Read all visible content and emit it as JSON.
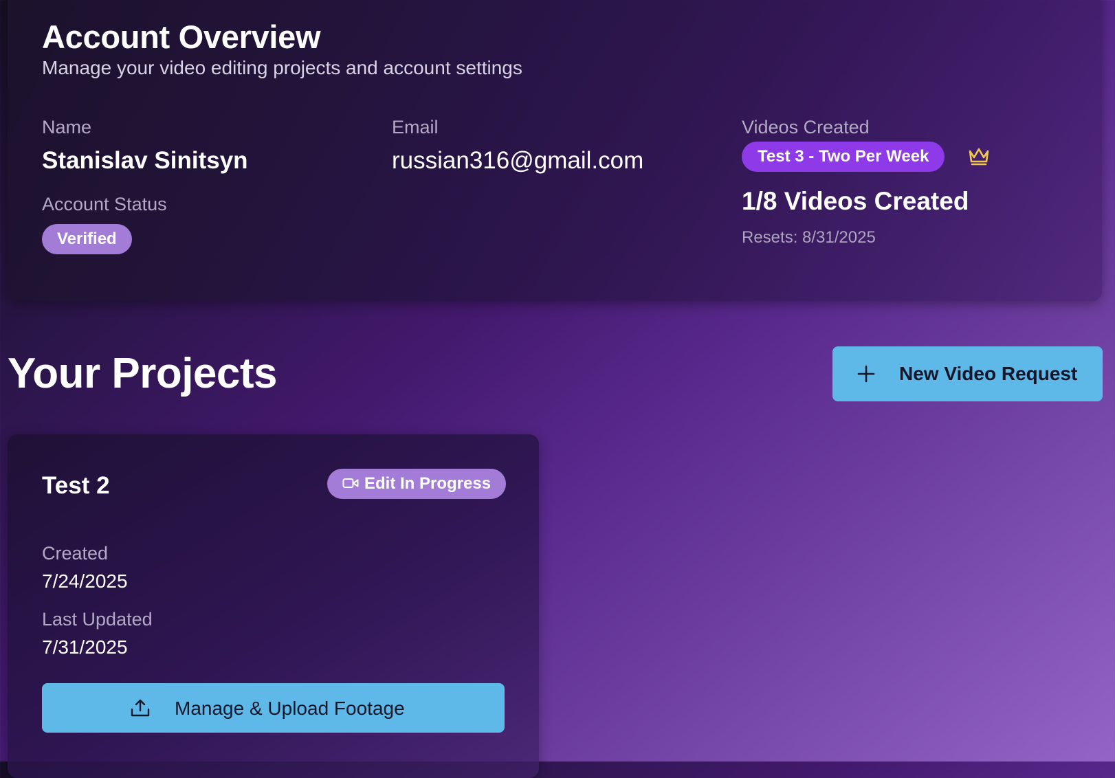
{
  "account": {
    "title": "Account Overview",
    "subtitle": "Manage your video editing projects and account settings",
    "name_label": "Name",
    "name_value": "Stanislav Sinitsyn",
    "email_label": "Email",
    "email_value": "russian316@gmail.com",
    "videos_label": "Videos Created",
    "plan_badge": "Test 3 - Two Per Week",
    "plan_icon": "crown-icon",
    "videos_count": "1/8 Videos Created",
    "resets": "Resets: 8/31/2025",
    "status_label": "Account Status",
    "status_badge": "Verified"
  },
  "projects": {
    "title": "Your Projects",
    "new_request_label": "New Video Request",
    "new_request_icon": "plus-icon",
    "items": [
      {
        "name": "Test 2",
        "status": "Edit In Progress",
        "status_icon": "video-camera-icon",
        "created_label": "Created",
        "created_value": "7/24/2025",
        "updated_label": "Last Updated",
        "updated_value": "7/31/2025",
        "action_label": "Manage & Upload Footage",
        "action_icon": "upload-icon"
      }
    ]
  },
  "colors": {
    "accent_blue": "#5eb8e8",
    "plan_purple": "#8f3ae8",
    "badge_lavender": "#a27cd6",
    "crown_gold": "#f2c94c"
  }
}
